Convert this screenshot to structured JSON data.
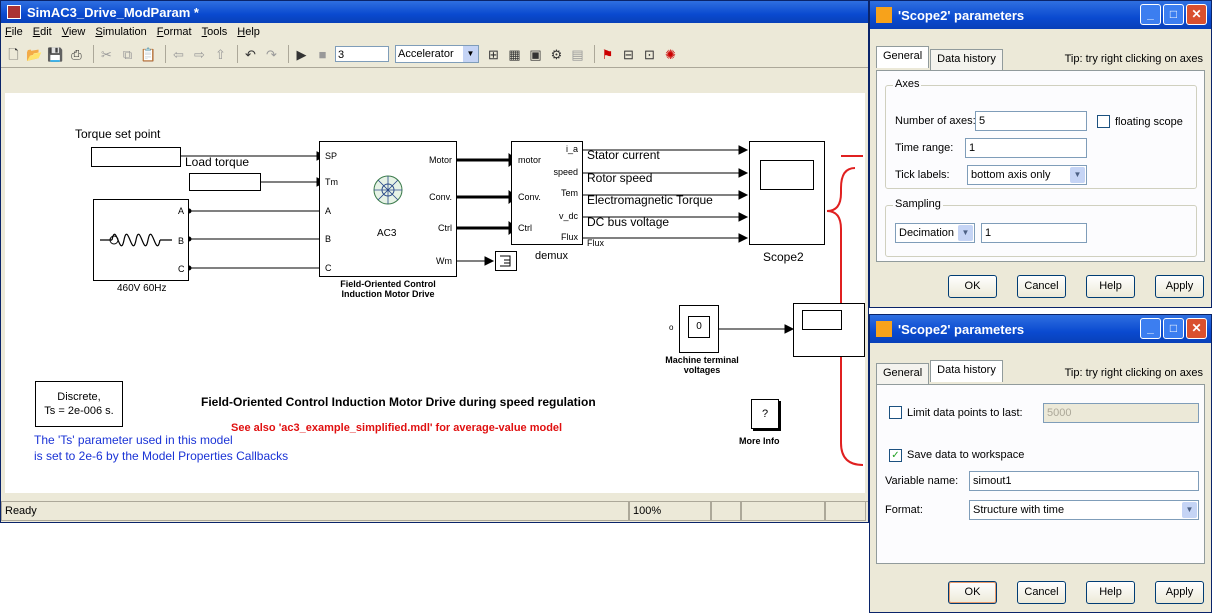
{
  "main_window": {
    "title": "SimAC3_Drive_ModParam *",
    "menu": [
      "File",
      "Edit",
      "View",
      "Simulation",
      "Format",
      "Tools",
      "Help"
    ],
    "stop_time": "3",
    "sim_mode": "Accelerator",
    "status": {
      "left": "Ready",
      "zoom": "100%"
    }
  },
  "diagram": {
    "torque_set_point": "Torque set point",
    "load_torque": "Load torque",
    "source_label": "460V 60Hz",
    "source_ports": [
      "A",
      "B",
      "C"
    ],
    "drive_in_ports": [
      "SP",
      "Tm",
      "A",
      "B",
      "C"
    ],
    "drive_out_ports": [
      "Motor",
      "Conv.",
      "Ctrl",
      "Wm"
    ],
    "drive_center": "AC3",
    "drive_caption": "Field-Oriented Control\nInduction Motor Drive",
    "demux_in_ports": [
      "motor",
      "Conv.",
      "Ctrl"
    ],
    "demux_out_ports": [
      "i_a",
      "speed",
      "Tem",
      "v_dc",
      "Flux"
    ],
    "demux_label": "demux",
    "flux_label": "Flux",
    "signals": [
      "Stator current",
      "Rotor speed",
      "Electromagnetic Torque",
      "DC bus voltage"
    ],
    "scope_label": "Scope2",
    "display_value": "0",
    "machine_terminal_caption": "Machine terminal\nvoltages",
    "discrete_block": "Discrete,\nTs = 2e-006 s.",
    "main_title": "Field-Oriented Control Induction Motor Drive during speed regulation",
    "see_also": "See also 'ac3_example_simplified.mdl' for average-value model",
    "ts_note_1": "The 'Ts' parameter used in this model",
    "ts_note_2": "is set to 2e-6  by the Model Properties Callbacks",
    "more_info_symbol": "?",
    "more_info_label": "More Info"
  },
  "dialog_general": {
    "title": "'Scope2' parameters",
    "tabs": [
      "General",
      "Data history"
    ],
    "tip": "Tip: try right clicking on axes",
    "axes_group": "Axes",
    "num_axes_label": "Number of axes:",
    "num_axes_value": "5",
    "floating_label": "floating scope",
    "time_range_label": "Time range:",
    "time_range_value": "1",
    "tick_labels_label": "Tick labels:",
    "tick_labels_value": "bottom axis only",
    "sampling_group": "Sampling",
    "sampling_mode": "Decimation",
    "sampling_value": "1",
    "buttons": [
      "OK",
      "Cancel",
      "Help",
      "Apply"
    ]
  },
  "dialog_history": {
    "title": "'Scope2' parameters",
    "tabs": [
      "General",
      "Data history"
    ],
    "tip": "Tip: try right clicking on axes",
    "limit_label": "Limit data points to last:",
    "limit_value": "5000",
    "save_label": "Save data to workspace",
    "varname_label": "Variable name:",
    "varname_value": "simout1",
    "format_label": "Format:",
    "format_value": "Structure with time",
    "buttons": [
      "OK",
      "Cancel",
      "Help",
      "Apply"
    ]
  },
  "colors": {
    "title_blue": "#0a4ad0",
    "see_also_red": "#e01010",
    "note_blue": "#1a33d6",
    "brace_red": "#e02020"
  }
}
